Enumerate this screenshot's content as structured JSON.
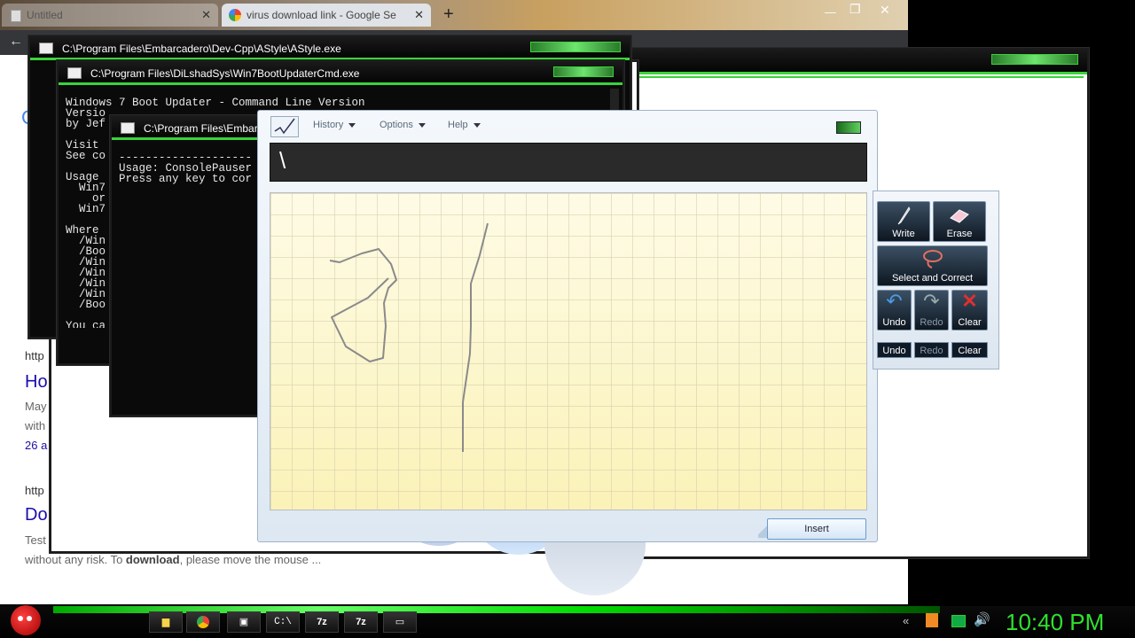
{
  "chrome": {
    "tabs": [
      {
        "title": "Untitled"
      },
      {
        "title": "virus download link - Google Se"
      }
    ],
    "new_tab": "+"
  },
  "page_snippets": {
    "url1": "http",
    "title1": "Ho",
    "meta1": "May",
    "meta2": "with",
    "meta3": "26 a",
    "url2": "http",
    "title2": "Do",
    "desc1": "Test",
    "desc2_pre": "without any risk. To ",
    "desc2_bold": "download",
    "desc2_post": ", please move the mouse ..."
  },
  "windows": {
    "astyle": {
      "title": "C:\\Program Files\\Embarcadero\\Dev-Cpp\\AStyle\\AStyle.exe"
    },
    "bootupdater": {
      "title": "C:\\Program Files\\DiLshadSys\\Win7BootUpdaterCmd.exe",
      "lines": "Windows 7 Boot Updater - Command Line Version\nVersio\nby Jef\n\nVisit\nSee co\n\nUsage\n  Win7\n    or\n  Win7\n\nWhere\n  /Win\n  /Boo\n  /Win\n  /Win\n  /Win\n  /Win\n  /Boo\n\nYou ca"
    },
    "pauser": {
      "title": "C:\\Program Files\\Embarcade",
      "lines": "--------------------\nUsage: ConsolePauser\nPress any key to cor"
    }
  },
  "tip": {
    "menus": [
      "History",
      "Options",
      "Help"
    ],
    "preview_text": "\\",
    "insert_label": "Insert"
  },
  "side": {
    "write": "Write",
    "erase": "Erase",
    "select_correct": "Select and Correct",
    "undo": "Undo",
    "redo": "Redo",
    "clear": "Clear",
    "small_undo": "Undo",
    "small_redo": "Redo",
    "small_clear": "Clear"
  },
  "taskbar": {
    "clock": "10:40 PM",
    "app_labels": [
      "7z",
      "7z"
    ],
    "accent": "#2fe02f"
  }
}
